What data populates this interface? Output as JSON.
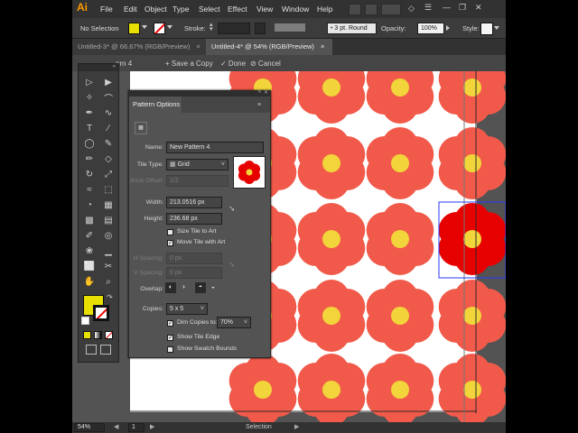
{
  "app": {
    "logo": "Ai"
  },
  "menu": [
    "File",
    "Edit",
    "Object",
    "Type",
    "Select",
    "Effect",
    "View",
    "Window",
    "Help"
  ],
  "control_bar": {
    "selection": "No Selection",
    "stroke_label": "Stroke:",
    "stroke_style": "3 pt. Round",
    "opacity_label": "Opacity:",
    "opacity_value": "100%",
    "style_label": "Style:"
  },
  "tabs": [
    {
      "label": "Untitled-3* @ 66.67% (RGB/Preview)",
      "close": "×"
    },
    {
      "label": "Untitled-4* @ 54% (RGB/Preview)",
      "close": "×"
    }
  ],
  "isolation_bar": {
    "path_fragment": "ern 4",
    "save_copy": "+ Save a Copy",
    "done": "✓ Done",
    "cancel": "⊘ Cancel"
  },
  "pattern_options": {
    "title": "Pattern Options",
    "name_label": "Name:",
    "name_value": "New Pattern 4",
    "tile_type_label": "Tile Type:",
    "tile_type_value": "Grid",
    "brick_offset_label": "Brick Offset:",
    "brick_offset_value": "1/2",
    "width_label": "Width:",
    "width_value": "213.0516 px",
    "height_label": "Height:",
    "height_value": "236.68 px",
    "size_tile_to_art": "Size Tile to Art",
    "size_tile_checked": false,
    "move_tile_with_art": "Move Tile with Art",
    "move_tile_checked": true,
    "h_spacing_label": "H Spacing:",
    "h_spacing_value": "0 px",
    "v_spacing_label": "V Spacing:",
    "v_spacing_value": "0 px",
    "overlap_label": "Overlap:",
    "copies_label": "Copies:",
    "copies_value": "5 x 5",
    "dim_copies_label": "Dim Copies to:",
    "dim_copies_checked": true,
    "dim_copies_value": "70%",
    "show_tile_edge": "Show Tile Edge",
    "show_tile_edge_checked": true,
    "show_swatch_bounds": "Show Swatch Bounds",
    "show_swatch_bounds_checked": false
  },
  "status_bar": {
    "zoom": "54%",
    "page": "1",
    "mode": "Selection"
  },
  "colors": {
    "petal": "#f15a4a",
    "petal_selected": "#e70000",
    "flower_center": "#f1d53a",
    "fill_swatch": "#e8e000",
    "canvas_bg": "#535353",
    "artboard": "#ffffff",
    "selection_outline": "#2a3aff"
  },
  "tools": [
    "selection-tool-icon",
    "direct-selection-tool-icon",
    "magic-wand-icon",
    "lasso-icon",
    "pen-tool-icon",
    "curvature-icon",
    "type-tool-icon",
    "line-tool-icon",
    "ellipse-tool-icon",
    "paintbrush-icon",
    "pencil-icon",
    "eraser-icon",
    "rotate-icon",
    "scale-icon",
    "width-icon",
    "free-transform-icon",
    "shape-builder-icon",
    "perspective-grid-icon",
    "mesh-icon",
    "gradient-icon",
    "eyedropper-icon",
    "blend-icon",
    "symbol-sprayer-icon",
    "graph-icon",
    "artboard-tool-icon",
    "slice-icon",
    "hand-tool-icon",
    "zoom-tool-icon"
  ]
}
